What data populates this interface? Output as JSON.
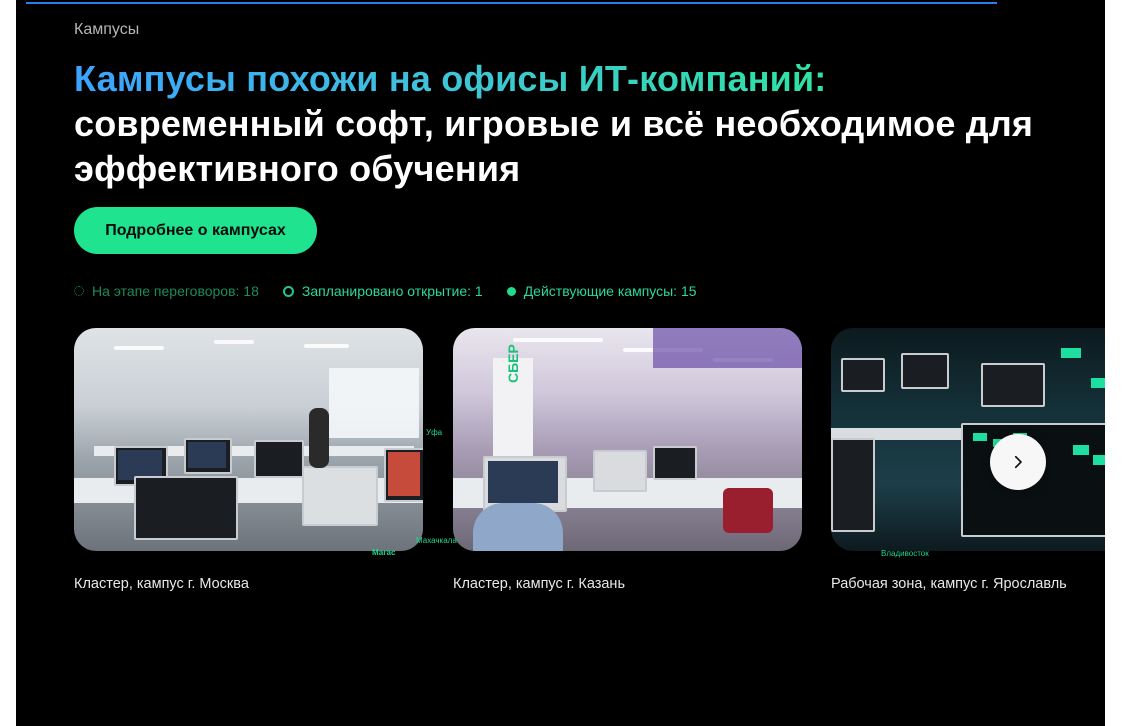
{
  "breadcrumb": "Кампусы",
  "headline": {
    "accent": "Кампусы похожи на офисы ИТ-компаний:",
    "rest": "современный софт, игровые и всё необходимое для эффективного обучения"
  },
  "cta_label": "Подробнее о кампусах",
  "legend": [
    {
      "label": "На этапе переговоров: 18",
      "icon": "dotted-circle-icon"
    },
    {
      "label": "Запланировано открытие: 1",
      "icon": "ring-icon"
    },
    {
      "label": "Действующие кампусы: 15",
      "icon": "filled-dot-icon"
    }
  ],
  "cards": [
    {
      "caption": "Кластер, кампус г. Москва"
    },
    {
      "caption": "Кластер, кампус г. Казань"
    },
    {
      "caption": "Рабочая зона, кампус г. Ярославль"
    }
  ],
  "map_labels": [
    "Уфа",
    "Магас",
    "Махачкала",
    "Владивосток"
  ],
  "carousel": {
    "next_icon": "chevron-right-icon"
  },
  "colors": {
    "background": "#000000",
    "accent_green": "#1fe38f",
    "topline_blue": "#2b7de9",
    "gradient_start": "#3ba3ff",
    "gradient_end": "#2fe3a2"
  }
}
